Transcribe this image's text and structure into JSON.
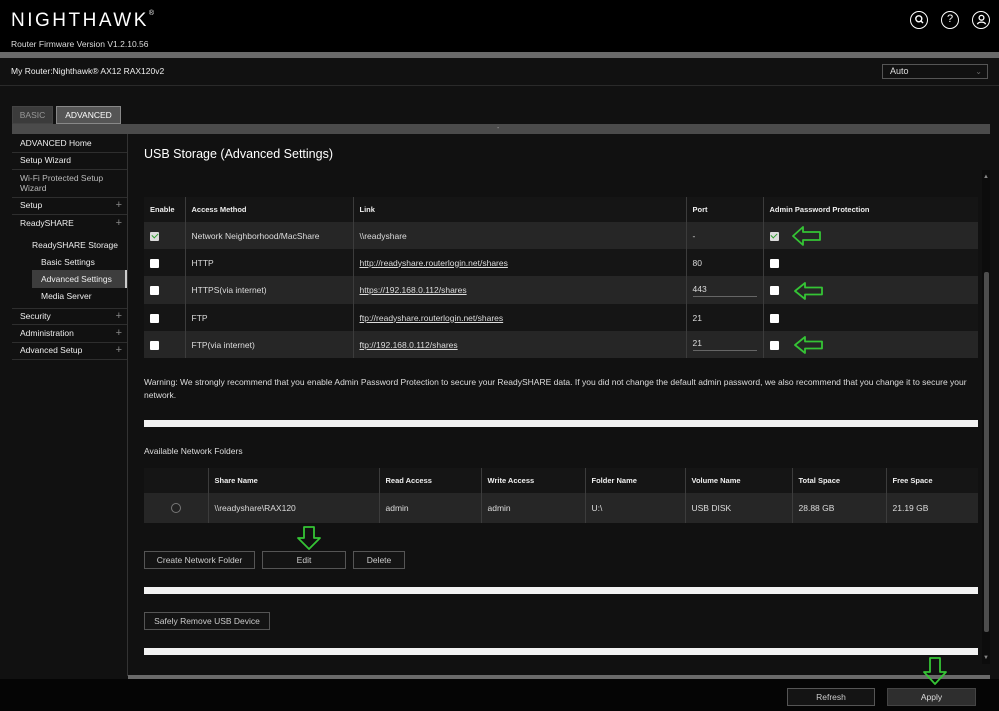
{
  "header": {
    "logo": "NIGHTHAWK",
    "logo_mark": "®",
    "firmware": "Router Firmware Version V1.2.10.56",
    "icons": [
      "search-icon",
      "help-icon",
      "user-icon"
    ]
  },
  "router": {
    "label": "My Router:",
    "model": "Nighthawk® AX12 RAX120v2",
    "language": "Auto"
  },
  "tabs": {
    "basic": "BASIC",
    "advanced": "ADVANCED",
    "strip_marker": "-"
  },
  "sidebar": {
    "items": [
      {
        "label": "ADVANCED Home",
        "plus": ""
      },
      {
        "label": "Setup Wizard",
        "plus": ""
      },
      {
        "label": "Wi-Fi Protected Setup Wizard",
        "plus": ""
      },
      {
        "label": "Setup",
        "plus": "+"
      },
      {
        "label": "ReadySHARE",
        "plus": "+"
      },
      {
        "label": "Security",
        "plus": "+"
      },
      {
        "label": "Administration",
        "plus": "+"
      },
      {
        "label": "Advanced Setup",
        "plus": "+"
      }
    ],
    "readyshare_storage": "ReadySHARE Storage",
    "basic_settings": "Basic Settings",
    "advanced_settings": "Advanced Settings",
    "media_server": "Media Server"
  },
  "main": {
    "title": "USB Storage (Advanced Settings)",
    "access_table": {
      "headers": [
        "Enable",
        "Access Method",
        "Link",
        "Port",
        "Admin Password Protection"
      ],
      "rows": [
        {
          "enabled": true,
          "method": "Network Neighborhood/MacShare",
          "link": "\\\\readyshare",
          "link_underlined": false,
          "port": "-",
          "port_editable": false,
          "protected": true
        },
        {
          "enabled": false,
          "method": "HTTP",
          "link": "http://readyshare.routerlogin.net/shares",
          "link_underlined": true,
          "port": "80",
          "port_editable": false,
          "protected": false
        },
        {
          "enabled": false,
          "method": "HTTPS(via internet)",
          "link": "https://192.168.0.112/shares",
          "link_underlined": true,
          "port": "443",
          "port_editable": true,
          "protected": false
        },
        {
          "enabled": false,
          "method": "FTP",
          "link": "ftp://readyshare.routerlogin.net/shares",
          "link_underlined": true,
          "port": "21",
          "port_editable": false,
          "protected": false
        },
        {
          "enabled": false,
          "method": "FTP(via internet)",
          "link": "ftp://192.168.0.112/shares",
          "link_underlined": true,
          "port": "21",
          "port_editable": true,
          "protected": false
        }
      ]
    },
    "warning": "Warning: We strongly recommend that you enable Admin Password Protection to secure your ReadySHARE data. If you did not change the default admin password, we also recommend that you change it to secure your network.",
    "folders_title": "Available Network Folders",
    "folders_table": {
      "headers": [
        "",
        "Share Name",
        "Read Access",
        "Write Access",
        "Folder Name",
        "Volume Name",
        "Total Space",
        "Free Space"
      ],
      "rows": [
        {
          "share": "\\\\readyshare\\RAX120",
          "read": "admin",
          "write": "admin",
          "folder": "U:\\",
          "volume": "USB DISK",
          "total": "28.88 GB",
          "free": "21.19 GB"
        }
      ]
    },
    "buttons": {
      "create": "Create Network Folder",
      "edit": "Edit",
      "delete": "Delete",
      "remove_usb": "Safely Remove USB Device"
    }
  },
  "footer": {
    "refresh": "Refresh",
    "apply": "Apply"
  },
  "colors": {
    "annotation_arrow": "#35c435",
    "checkmark": "#2e9c2e"
  }
}
